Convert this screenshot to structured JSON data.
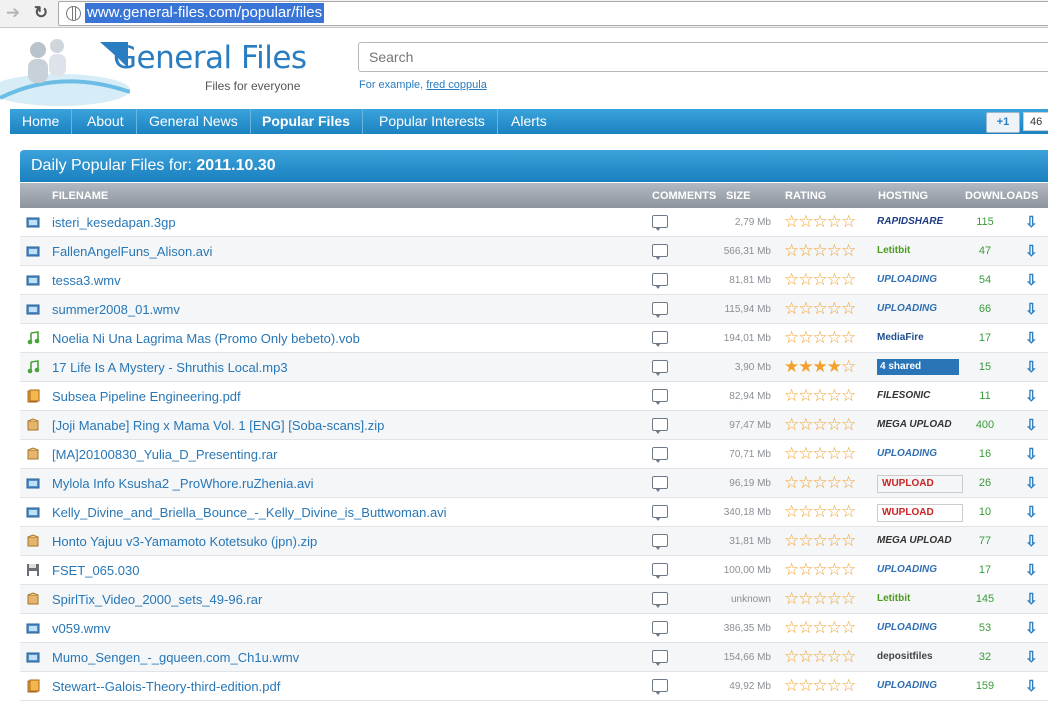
{
  "browser": {
    "url": "www.general-files.com/popular/files"
  },
  "header": {
    "logo_text": "General Files",
    "tagline": "Files for everyone",
    "search_placeholder": "Search",
    "example_prefix": "For example,",
    "example_link": "fred coppula"
  },
  "nav": [
    "Home",
    "About",
    "General News",
    "Popular Files",
    "Popular Interests",
    "Alerts"
  ],
  "social": {
    "plus_label": "+1",
    "count": "46"
  },
  "panel": {
    "title_prefix": "Daily Popular Files for:",
    "date": "2011.10.30"
  },
  "columns": [
    "FILENAME",
    "COMMENTS",
    "SIZE",
    "RATING",
    "HOSTING",
    "DOWNLOADS"
  ],
  "rows": [
    {
      "name": "isteri_kesedapan.3gp",
      "size": "2,79 Mb",
      "rating": 0,
      "host": "RAPIDSHARE",
      "downloads": "115",
      "type": "video"
    },
    {
      "name": "FallenAngelFuns_Alison.avi",
      "size": "566,31 Mb",
      "rating": 0,
      "host": "Letitbit",
      "downloads": "47",
      "type": "video"
    },
    {
      "name": "tessa3.wmv",
      "size": "81,81 Mb",
      "rating": 0,
      "host": "UPLOADING",
      "downloads": "54",
      "type": "video"
    },
    {
      "name": "summer2008_01.wmv",
      "size": "115,94 Mb",
      "rating": 0,
      "host": "UPLOADING",
      "downloads": "66",
      "type": "video"
    },
    {
      "name": "Noelia Ni Una Lagrima Mas (Promo Only bebeto).vob",
      "size": "194,01 Mb",
      "rating": 0,
      "host": "MediaFire",
      "downloads": "17",
      "type": "audio"
    },
    {
      "name": "17 Life Is A Mystery - Shruthis Local.mp3",
      "size": "3,90 Mb",
      "rating": 4,
      "host": "4 shared",
      "downloads": "15",
      "type": "audio"
    },
    {
      "name": "Subsea Pipeline Engineering.pdf",
      "size": "82,94 Mb",
      "rating": 0,
      "host": "FILESONIC",
      "downloads": "11",
      "type": "doc"
    },
    {
      "name": "[Joji Manabe] Ring x Mama Vol. 1 [ENG] [Soba-scans].zip",
      "size": "97,47 Mb",
      "rating": 0,
      "host": "MEGA UPLOAD",
      "downloads": "400",
      "type": "archive"
    },
    {
      "name": "[MA]20100830_Yulia_D_Presenting.rar",
      "size": "70,71 Mb",
      "rating": 0,
      "host": "UPLOADING",
      "downloads": "16",
      "type": "archive"
    },
    {
      "name": "Mylola Info Ksusha2 _ProWhore.ruZhenia.avi",
      "size": "96,19 Mb",
      "rating": 0,
      "host": "WUPLOAD",
      "downloads": "26",
      "type": "video"
    },
    {
      "name": "Kelly_Divine_and_Briella_Bounce_-_Kelly_Divine_is_Buttwoman.avi",
      "size": "340,18 Mb",
      "rating": 0,
      "host": "WUPLOAD",
      "downloads": "10",
      "type": "video"
    },
    {
      "name": "Honto Yajuu v3-Yamamoto Kotetsuko (jpn).zip",
      "size": "31,81 Mb",
      "rating": 0,
      "host": "MEGA UPLOAD",
      "downloads": "77",
      "type": "archive"
    },
    {
      "name": "FSET_065.030",
      "size": "100,00 Mb",
      "rating": 0,
      "host": "UPLOADING",
      "downloads": "17",
      "type": "disk"
    },
    {
      "name": "SpirlTix_Video_2000_sets_49-96.rar",
      "size": "unknown",
      "rating": 0,
      "host": "Letitbit",
      "downloads": "145",
      "type": "archive"
    },
    {
      "name": "v059.wmv",
      "size": "386,35 Mb",
      "rating": 0,
      "host": "UPLOADING",
      "downloads": "53",
      "type": "video"
    },
    {
      "name": "Mumo_Sengen_-_gqueen.com_Ch1u.wmv",
      "size": "154,66 Mb",
      "rating": 0,
      "host": "depositfiles",
      "downloads": "32",
      "type": "video"
    },
    {
      "name": "Stewart--Galois-Theory-third-edition.pdf",
      "size": "49,92 Mb",
      "rating": 0,
      "host": "UPLOADING",
      "downloads": "159",
      "type": "doc"
    }
  ],
  "colors": {
    "accent": "#2a91cc",
    "link": "#2877b6",
    "downloads": "#3a9a3a",
    "star": "#f2a12c"
  }
}
